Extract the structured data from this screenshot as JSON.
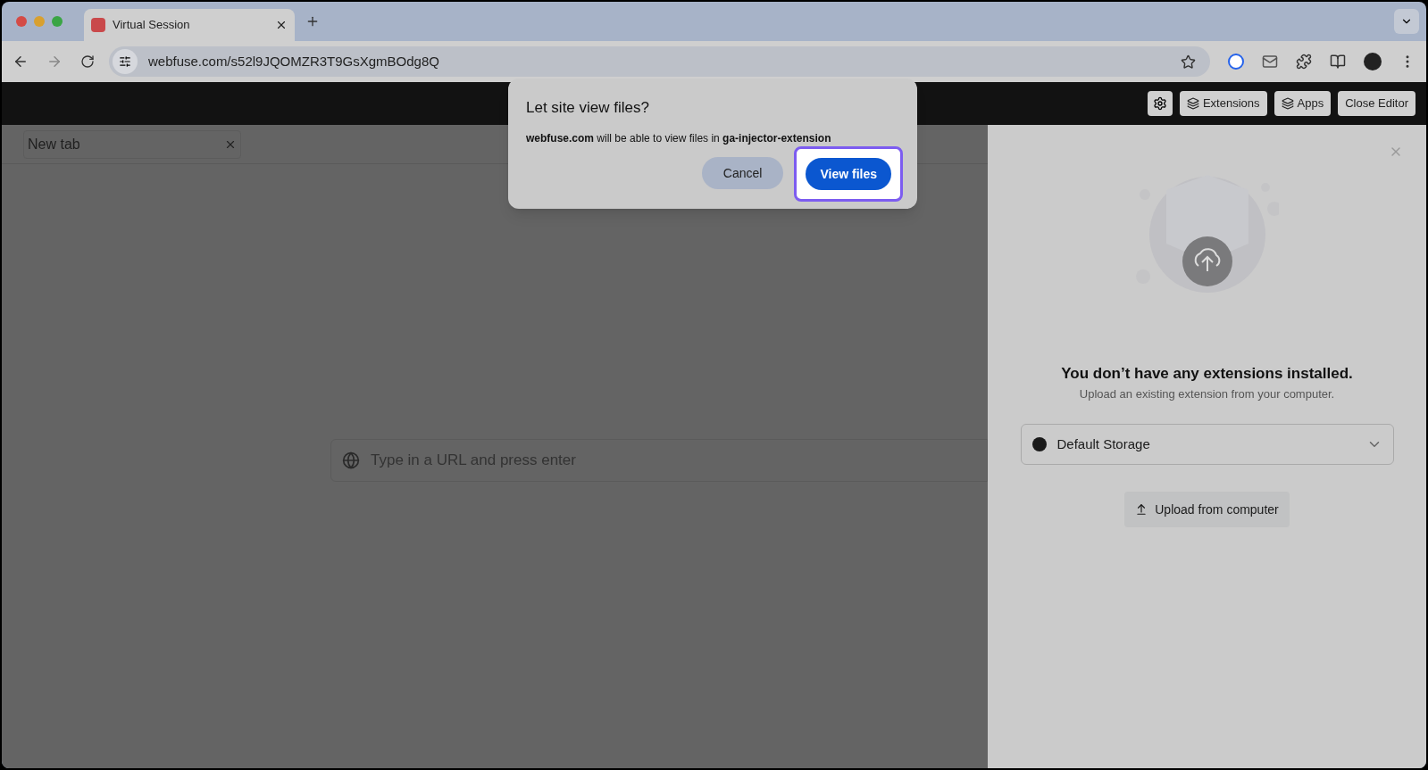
{
  "browser": {
    "tab": {
      "title": "Virtual Session"
    },
    "url": "webfuse.com/s52l9JQOMZR3T9GsXgmBOdg8Q"
  },
  "app_header": {
    "buttons": [
      "Extensions",
      "Apps",
      "Close Editor"
    ]
  },
  "session": {
    "tab": {
      "title": "New tab"
    },
    "url_field": {
      "placeholder": "Type in a URL and press enter"
    }
  },
  "extensions_panel": {
    "title": "You don’t have any extensions installed.",
    "subtitle": "Upload an existing extension from your computer.",
    "storage_select": {
      "value": "Default Storage"
    },
    "upload_button": "Upload from computer"
  },
  "dialog": {
    "title": "Let site view files?",
    "message": "**webfuse.com** will be able to view files in **ga-injector-extension**",
    "buttons": [
      {
        "label": "Cancel",
        "kind": "secondary",
        "highlighted": false
      },
      {
        "label": "View files",
        "kind": "primary",
        "highlighted": true
      }
    ]
  }
}
